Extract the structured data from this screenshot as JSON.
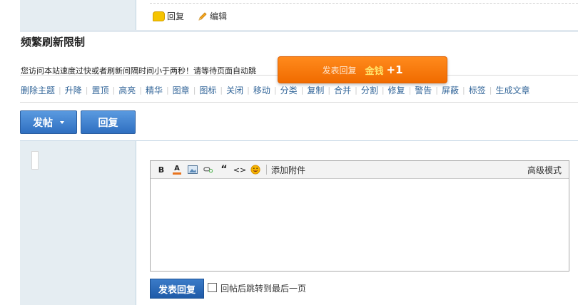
{
  "post_actions": {
    "reply": "回复",
    "edit": "编辑"
  },
  "notice": {
    "title": "频繁刷新限制",
    "text": "您访问本站速度过快或者刷新间隔时间小于两秒！请等待页面自动跳"
  },
  "toast": {
    "text": "发表回复",
    "coins": "金钱",
    "plus": "+1"
  },
  "moderation": [
    "删除主题",
    "升降",
    "置顶",
    "高亮",
    "精华",
    "图章",
    "图标",
    "关闭",
    "移动",
    "分类",
    "复制",
    "合并",
    "分割",
    "修复",
    "警告",
    "屏蔽",
    "标签",
    "生成文章"
  ],
  "buttons": {
    "post": "发帖",
    "reply": "回复"
  },
  "editor": {
    "toolbar": {
      "bold": "B",
      "font_color": "A",
      "quote": "“",
      "code": "<>",
      "attach": "添加附件",
      "advanced": "高级模式"
    }
  },
  "submit": {
    "label": "发表回复",
    "jump_label": "回帖后跳转到最后一页"
  },
  "colors": {
    "link": "#336699",
    "accent_orange": "#f57a0e",
    "button_blue": "#2f6fc0"
  }
}
